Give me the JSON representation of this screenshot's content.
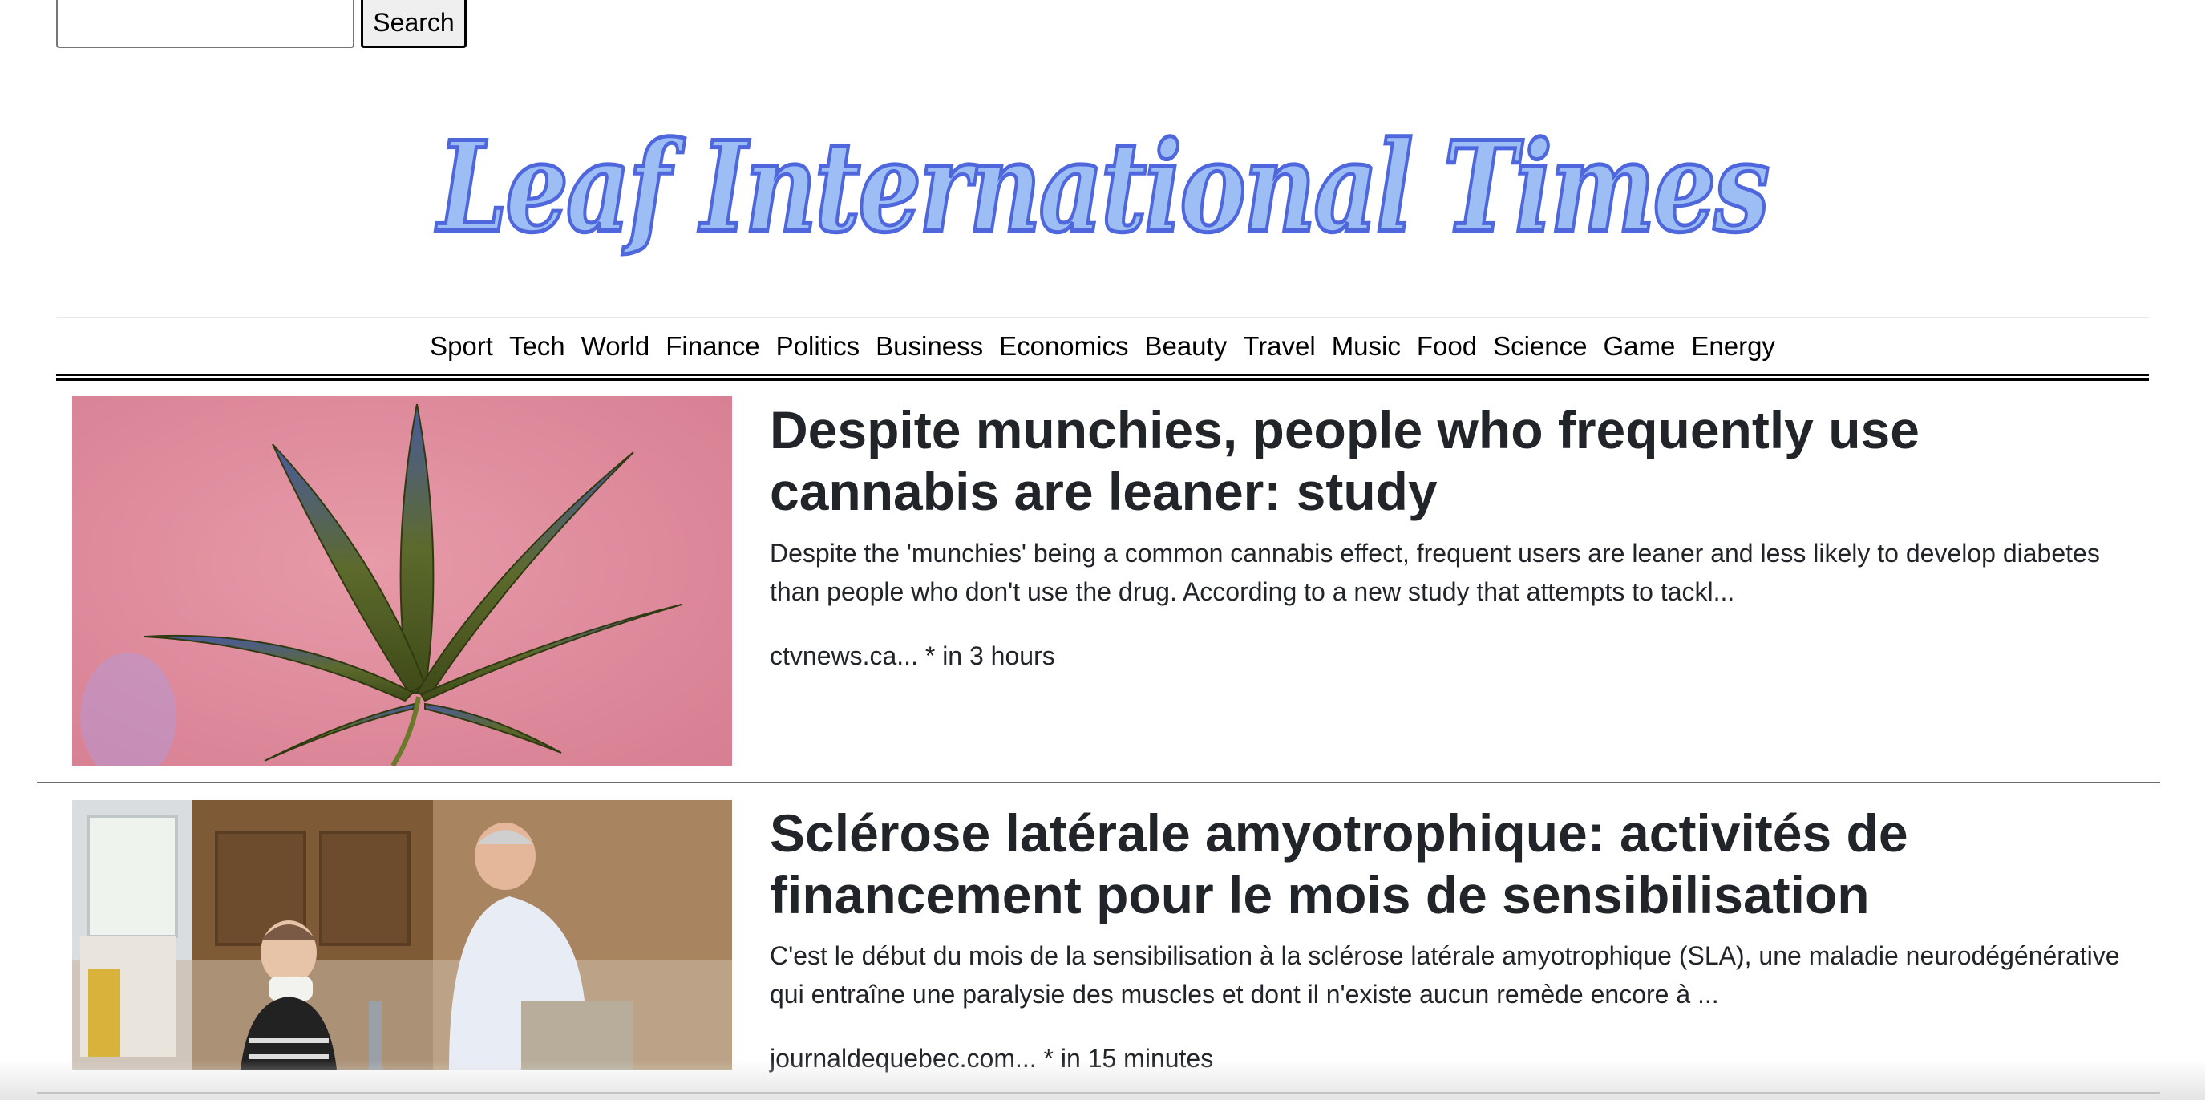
{
  "search": {
    "placeholder": "",
    "value": "",
    "button_label": "Search"
  },
  "masthead": {
    "logo_text": "Leaf International Times"
  },
  "nav": {
    "items": [
      "Sport",
      "Tech",
      "World",
      "Finance",
      "Politics",
      "Business",
      "Economics",
      "Beauty",
      "Travel",
      "Music",
      "Food",
      "Science",
      "Game",
      "Energy"
    ]
  },
  "articles": [
    {
      "title": "Despite munchies, people who frequently use cannabis are leaner: study",
      "summary": "Despite the 'munchies' being a common cannabis effect, frequent users are leaner and less likely to develop diabetes than people who don't use the drug. According to a new study that attempts to tackl...",
      "meta": "ctvnews.ca... * in 3 hours",
      "image_icon": "cannabis-leaf-photo"
    },
    {
      "title": "Sclérose latérale amyotrophique: activités de financement pour le mois de sensibilisation",
      "summary": "C'est le début du mois de la sensibilisation à la sclérose latérale amyotrophique (SLA), une maladie neurodégénérative qui entraîne une paralysie des muscles et dont il n'existe aucun remède encore à ...",
      "meta": "journaldequebec.com... * in 15 minutes",
      "image_icon": "elderly-couple-photo"
    }
  ],
  "colors": {
    "logo_fill": "#9dbef5",
    "logo_stroke": "#4f67dc",
    "text": "#212529",
    "image1_background": "#e08d9e"
  }
}
